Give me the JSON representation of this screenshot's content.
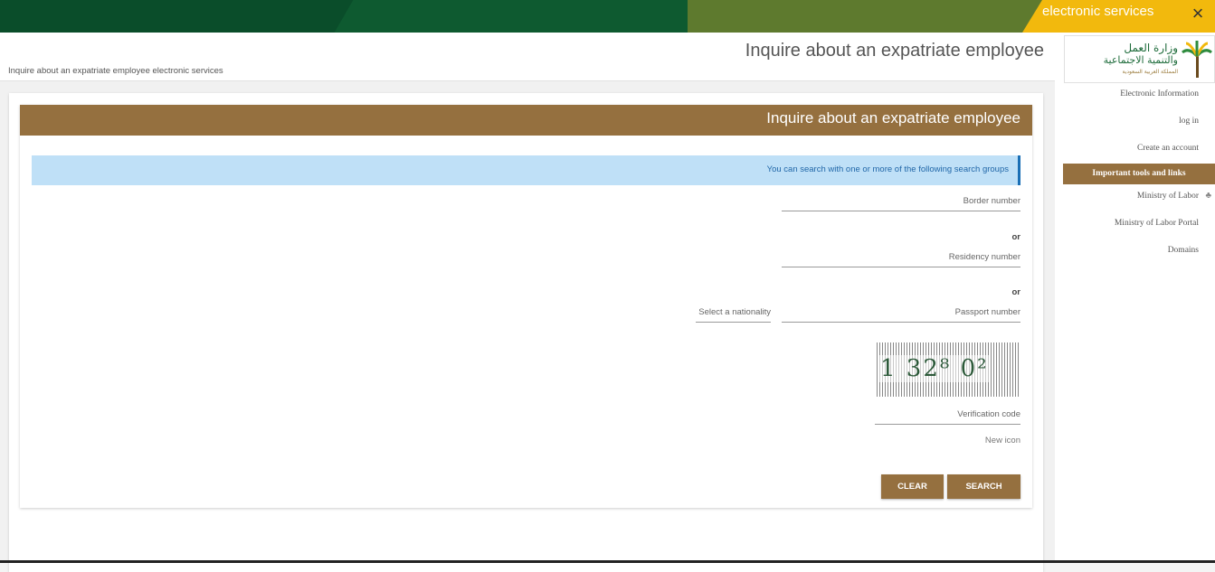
{
  "topbar": {
    "tab_label": "electronic services",
    "close_icon": "×"
  },
  "header": {
    "title": "Inquire about an expatriate employee",
    "breadcrumb": "Inquire about an expatriate employee  electronic services"
  },
  "card": {
    "title": "Inquire about an expatriate employee",
    "info": "You can search with one or more of the following search groups",
    "border_label": "Border number",
    "or1": "or",
    "residency_label": "Residency number",
    "or2": "or",
    "passport_label": "Passport number",
    "nationality_label": "Select a nationality",
    "captcha_text": "1 32⁸ 0²",
    "verification_label": "Verification code",
    "new_icon": "New icon",
    "clear_label": "CLEAR",
    "search_label": "SEARCH"
  },
  "sidebar": {
    "logo_line1": "وزارة العمل",
    "logo_line2": "والتنمية الاجتماعية",
    "logo_line3": "المملكة العربية السعودية",
    "items": [
      {
        "label": "Electronic Information"
      },
      {
        "label": "log in"
      },
      {
        "label": "Create an account"
      },
      {
        "label": "Important tools and links"
      },
      {
        "label": "Ministry of Labor"
      },
      {
        "label": "Ministry of Labor Portal"
      },
      {
        "label": "Domains"
      }
    ]
  },
  "colors": {
    "brand_brown": "#95703f",
    "top_green": "#0a4d2a",
    "accent_yellow": "#f2b90d",
    "info_blue": "#bfe0f7"
  }
}
